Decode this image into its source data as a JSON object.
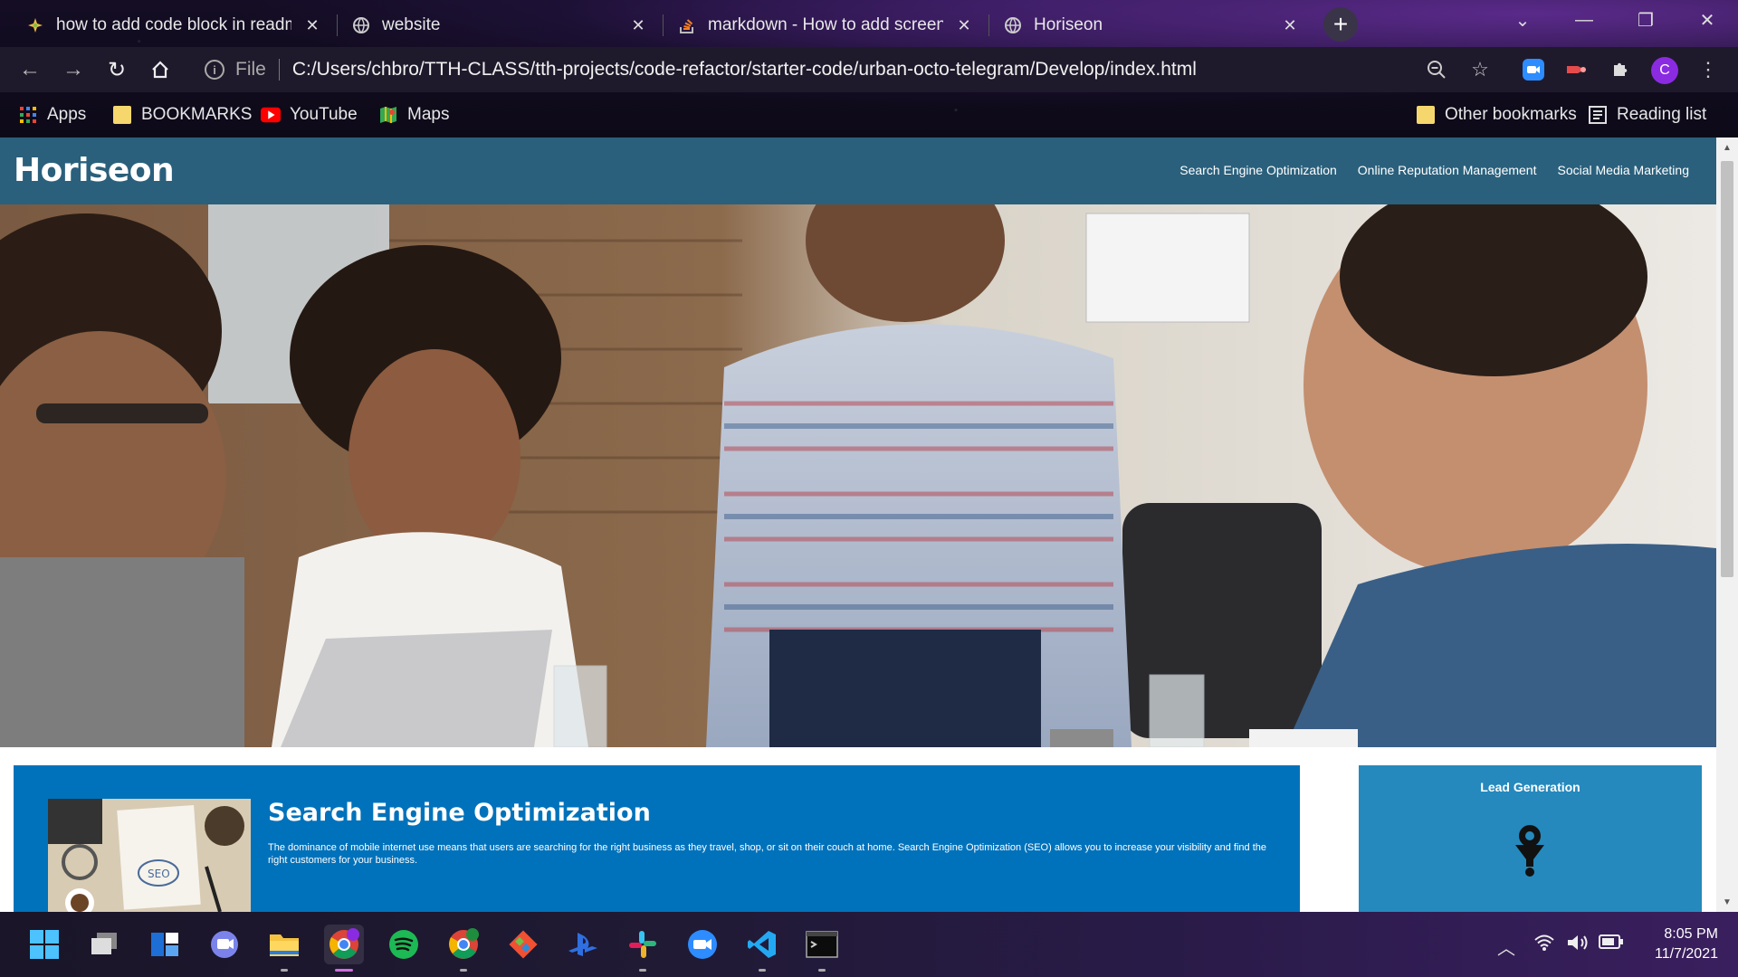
{
  "browser": {
    "tabs": [
      {
        "title": "how to add code block in readme",
        "favicon": "spark-favicon",
        "active": false
      },
      {
        "title": "website",
        "favicon": "globe-favicon",
        "active": false
      },
      {
        "title": "markdown - How to add screenshots",
        "favicon": "stackoverflow-favicon",
        "active": false
      },
      {
        "title": "Horiseon",
        "favicon": "globe-favicon",
        "active": true
      }
    ],
    "new_tab_label": "+",
    "address": {
      "scheme_label": "File",
      "url": "C:/Users/chbro/TTH-CLASS/tth-projects/code-refactor/starter-code/urban-octo-telegram/Develop/index.html"
    },
    "profile_initial": "C",
    "bookmarks": [
      {
        "label": "Apps",
        "icon": "apps-grid-icon"
      },
      {
        "label": "BOOKMARKS",
        "icon": "folder-icon"
      },
      {
        "label": "YouTube",
        "icon": "youtube-icon"
      },
      {
        "label": "Maps",
        "icon": "maps-icon"
      }
    ],
    "other_bookmarks": "Other bookmarks",
    "reading_list": "Reading list"
  },
  "site": {
    "logo": "Horiseon",
    "nav": [
      "Search Engine Optimization",
      "Online Reputation Management",
      "Social Media Marketing"
    ],
    "article": {
      "title": "Search Engine Optimization",
      "body": "The dominance of mobile internet use means that users are searching for the right business as they travel, shop, or sit on their couch at home. Search Engine Optimization (SEO) allows you to increase your visibility and find the right customers for your business."
    },
    "sidebar": {
      "title": "Lead Generation"
    }
  },
  "taskbar": {
    "time": "8:05 PM",
    "date": "11/7/2021",
    "apps": [
      "start-icon",
      "task-view-icon",
      "widgets-icon",
      "teams-chat-icon",
      "file-explorer-icon",
      "chrome-icon",
      "spotify-icon",
      "chrome-profile-icon",
      "git-icon",
      "playstation-icon",
      "slack-icon",
      "zoom-icon",
      "vscode-icon",
      "terminal-icon"
    ]
  },
  "colors": {
    "site_header": "#2a607c",
    "article_bg": "#0072bb",
    "sidebar_bg": "#2589bd"
  }
}
